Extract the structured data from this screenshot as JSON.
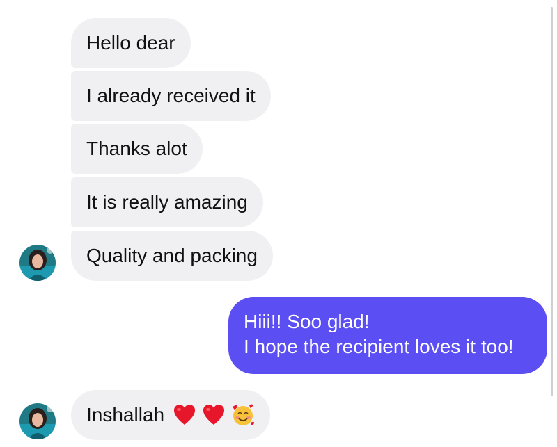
{
  "conversation": {
    "incoming_group": [
      {
        "text": "Hello dear"
      },
      {
        "text": "I already received it"
      },
      {
        "text": "Thanks alot"
      },
      {
        "text": "It is really amazing"
      },
      {
        "text": "Quality and packing"
      }
    ],
    "outgoing": {
      "line1": "Hiii!! Soo glad!",
      "line2": "I hope the recipient loves it too!"
    },
    "reply": {
      "text": "Inshallah",
      "emojis": [
        "red-heart-emoji",
        "red-heart-emoji",
        "smiling-face-with-hearts-emoji"
      ]
    }
  },
  "colors": {
    "incoming_bubble": "#f0f0f2",
    "outgoing_bubble": "#5b4ef3",
    "heart": "#e8162a",
    "face": "#f7c23a"
  }
}
